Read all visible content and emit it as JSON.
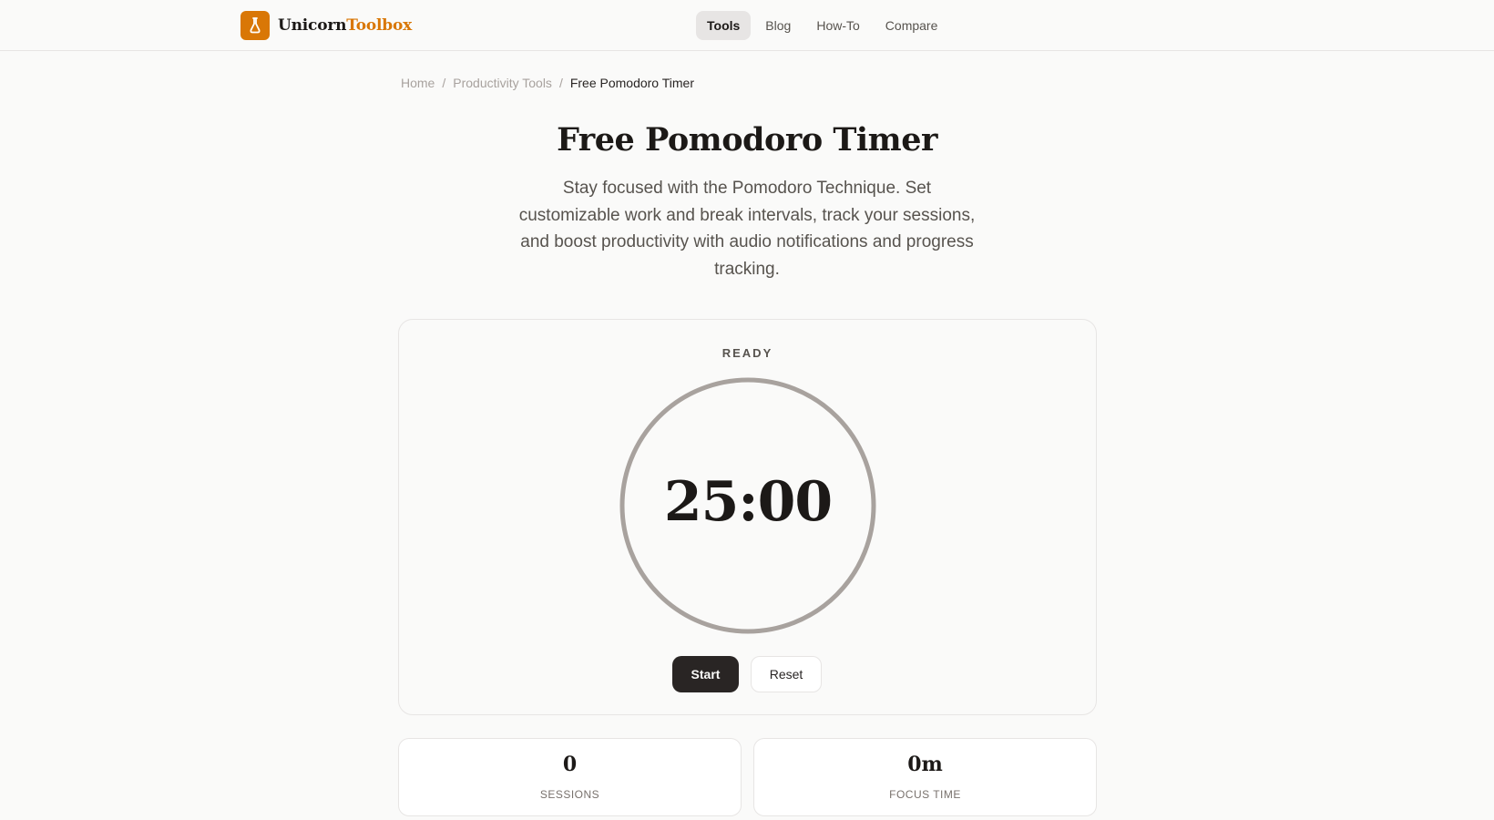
{
  "brand": {
    "name_part1": "Unicorn",
    "name_part2": "Toolbox",
    "accent_color": "#d97706",
    "logo_icon": "flask-icon"
  },
  "nav": {
    "items": [
      "Tools",
      "Blog",
      "How-To",
      "Compare"
    ],
    "active": "Tools"
  },
  "breadcrumb": {
    "items": [
      "Home",
      "Productivity Tools"
    ],
    "current": "Free Pomodoro Timer"
  },
  "page": {
    "title": "Free Pomodoro Timer",
    "description": "Stay focused with the Pomodoro Technique. Set customizable work and break intervals, track your sessions, and boost productivity with audio notifications and progress tracking."
  },
  "timer": {
    "status": "READY",
    "display": "25:00",
    "progress": 0,
    "start_label": "Start",
    "reset_label": "Reset"
  },
  "stats": [
    {
      "value": "0",
      "label": "SESSIONS"
    },
    {
      "value": "0m",
      "label": "FOCUS TIME"
    }
  ]
}
